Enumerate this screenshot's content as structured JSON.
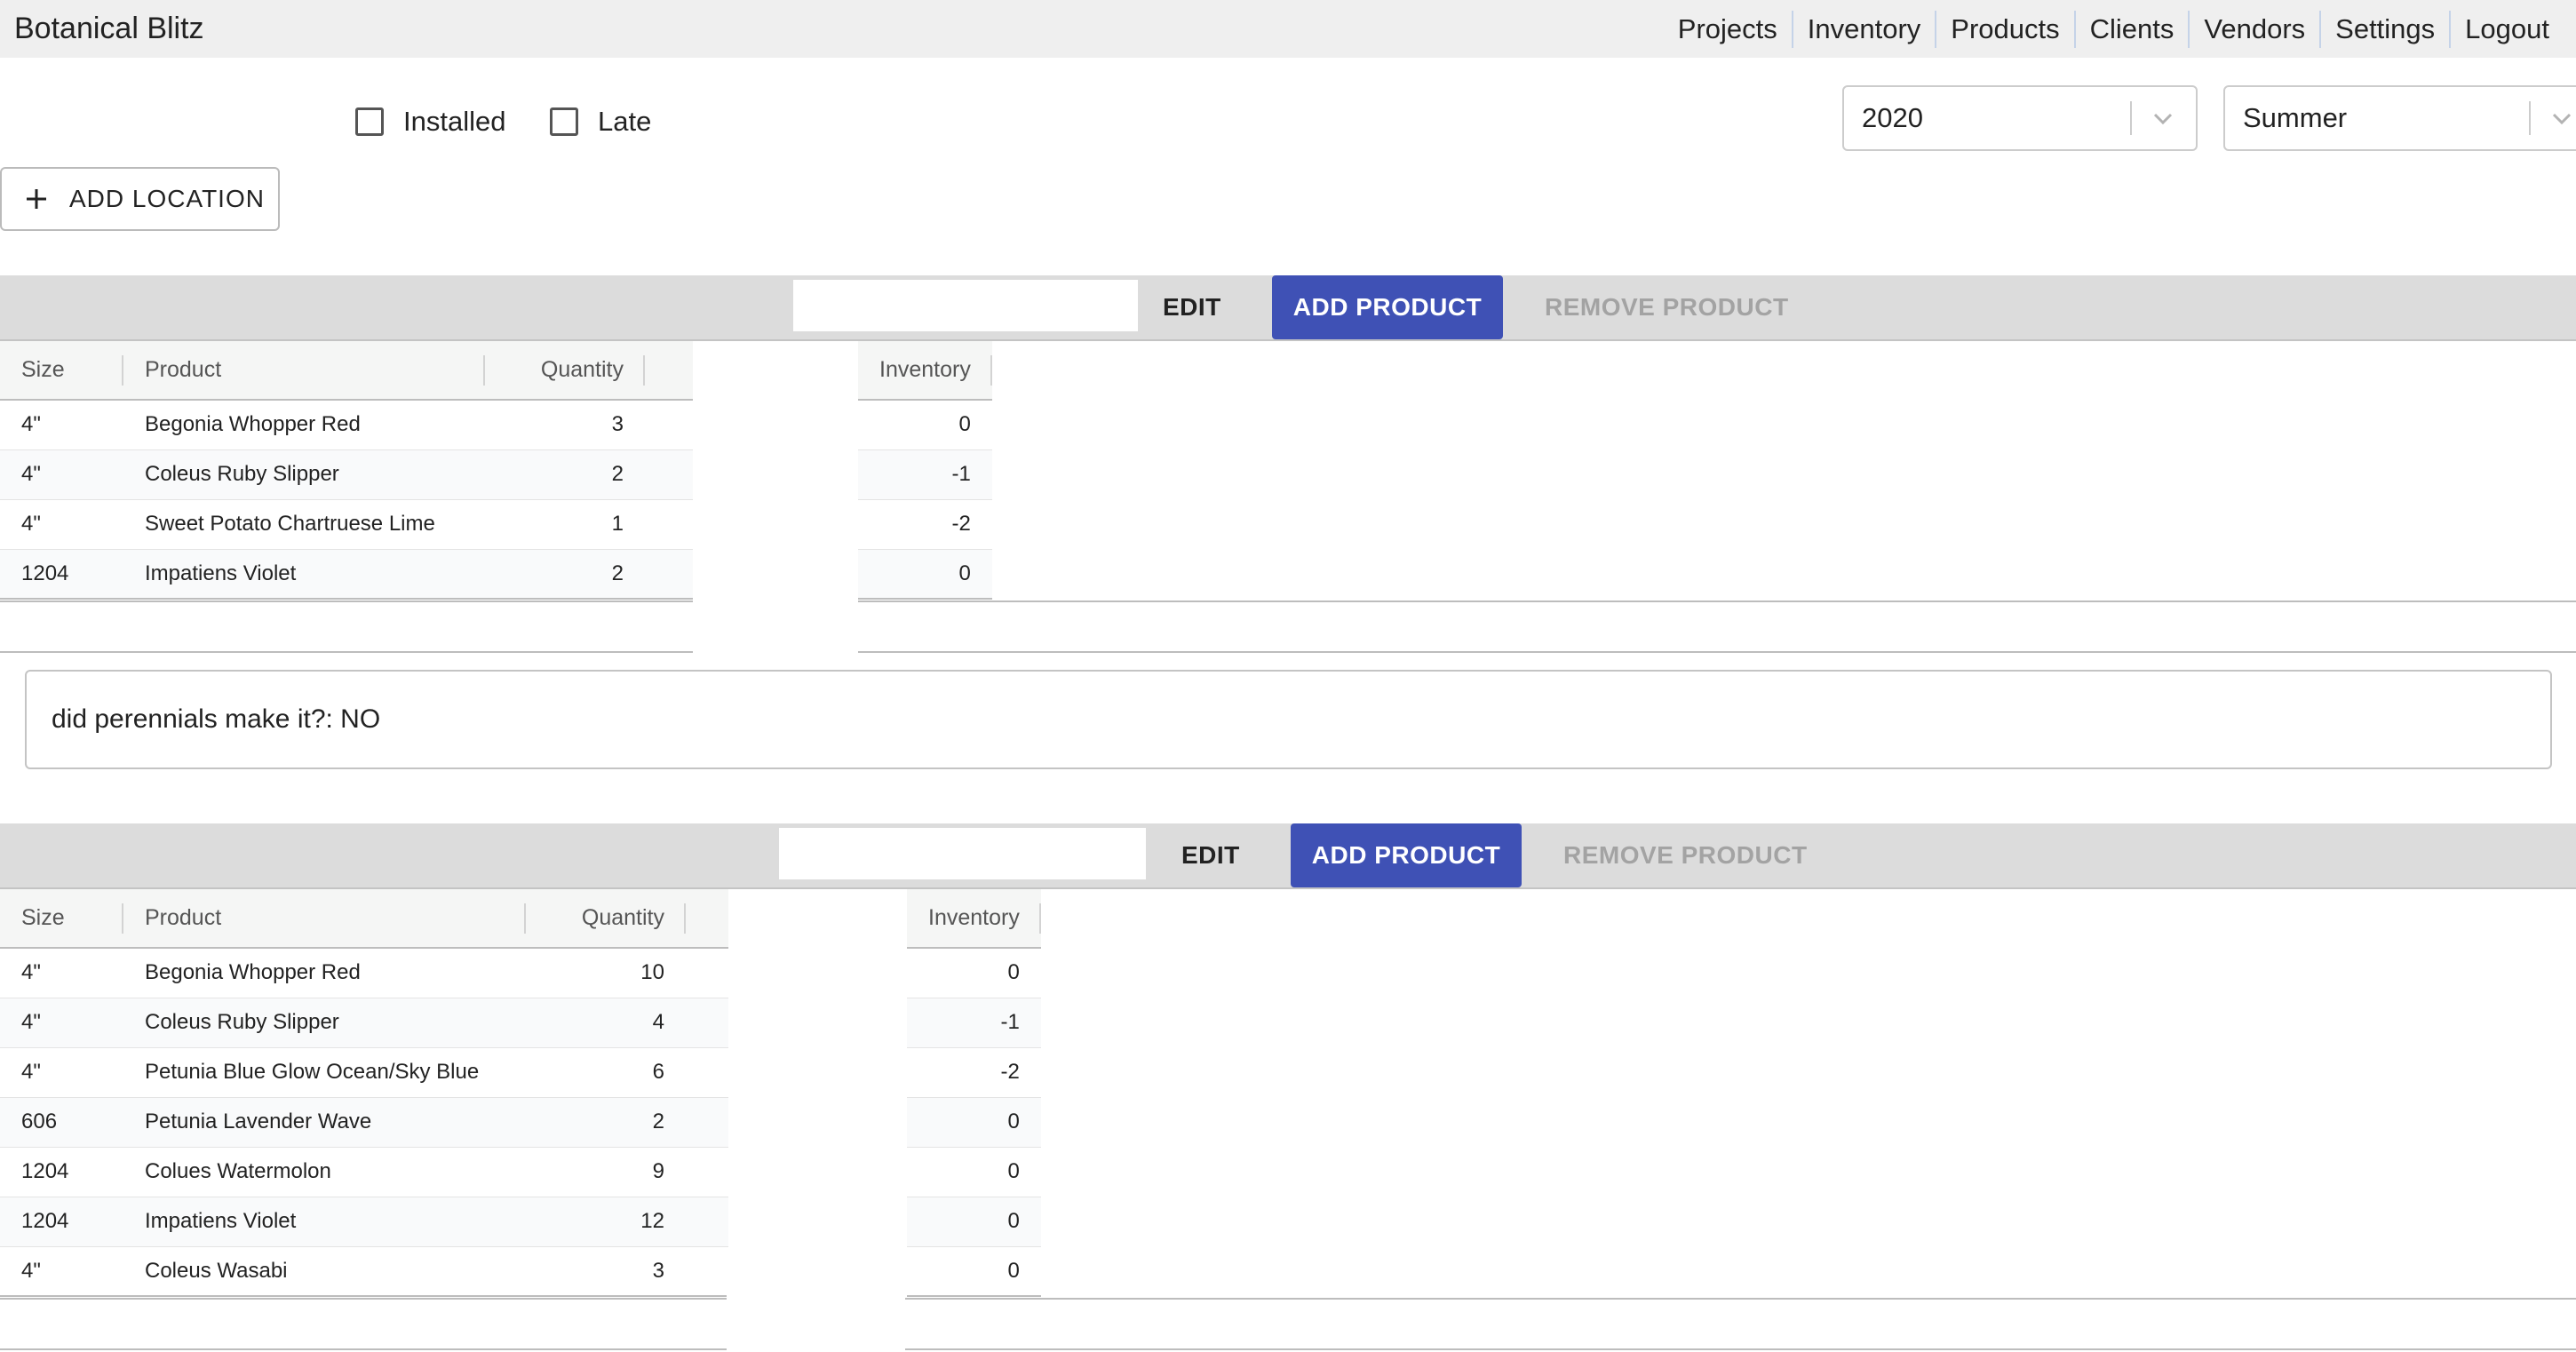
{
  "app": {
    "title": "Botanical Blitz"
  },
  "nav": {
    "links": [
      "Projects",
      "Inventory",
      "Products",
      "Clients",
      "Vendors",
      "Settings",
      "Logout"
    ]
  },
  "filters": {
    "installed_label": "Installed",
    "late_label": "Late",
    "installed_checked": false,
    "late_checked": false,
    "year": "2020",
    "season": "Summer"
  },
  "actions": {
    "add_location": "ADD LOCATION"
  },
  "columns": {
    "size": "Size",
    "product": "Product",
    "quantity": "Quantity",
    "inventory": "Inventory"
  },
  "toolbar": {
    "edit": "EDIT",
    "add_product": "ADD PRODUCT",
    "remove_product": "REMOVE PRODUCT"
  },
  "locations": [
    {
      "name": "",
      "rows": [
        {
          "size": "4\"",
          "product": "Begonia Whopper Red",
          "quantity": "3",
          "inventory": "0"
        },
        {
          "size": "4\"",
          "product": "Coleus Ruby Slipper",
          "quantity": "2",
          "inventory": "-1"
        },
        {
          "size": "4\"",
          "product": "Sweet Potato Chartruese Lime",
          "quantity": "1",
          "inventory": "-2"
        },
        {
          "size": "1204",
          "product": "Impatiens Violet",
          "quantity": "2",
          "inventory": "0"
        }
      ],
      "notes": "did perennials make it?: NO"
    },
    {
      "name": "",
      "rows": [
        {
          "size": "4\"",
          "product": "Begonia Whopper Red",
          "quantity": "10",
          "inventory": "0"
        },
        {
          "size": "4\"",
          "product": "Coleus Ruby Slipper",
          "quantity": "4",
          "inventory": "-1"
        },
        {
          "size": "4\"",
          "product": "Petunia Blue Glow Ocean/Sky Blue",
          "quantity": "6",
          "inventory": "-2"
        },
        {
          "size": "606",
          "product": "Petunia Lavender Wave",
          "quantity": "2",
          "inventory": "0"
        },
        {
          "size": "1204",
          "product": "Colues Watermolon",
          "quantity": "9",
          "inventory": "0"
        },
        {
          "size": "1204",
          "product": "Impatiens Violet",
          "quantity": "12",
          "inventory": "0"
        },
        {
          "size": "4\"",
          "product": "Coleus Wasabi",
          "quantity": "3",
          "inventory": "0"
        }
      ]
    }
  ],
  "colors": {
    "primary": "#3f51b5",
    "navbar": "#efefef",
    "toolbar": "#dcdcdc",
    "disabled_text": "#a3a3a3"
  },
  "icons": {
    "add_location": "plus-icon",
    "select_arrow": "chevron-down-icon"
  }
}
